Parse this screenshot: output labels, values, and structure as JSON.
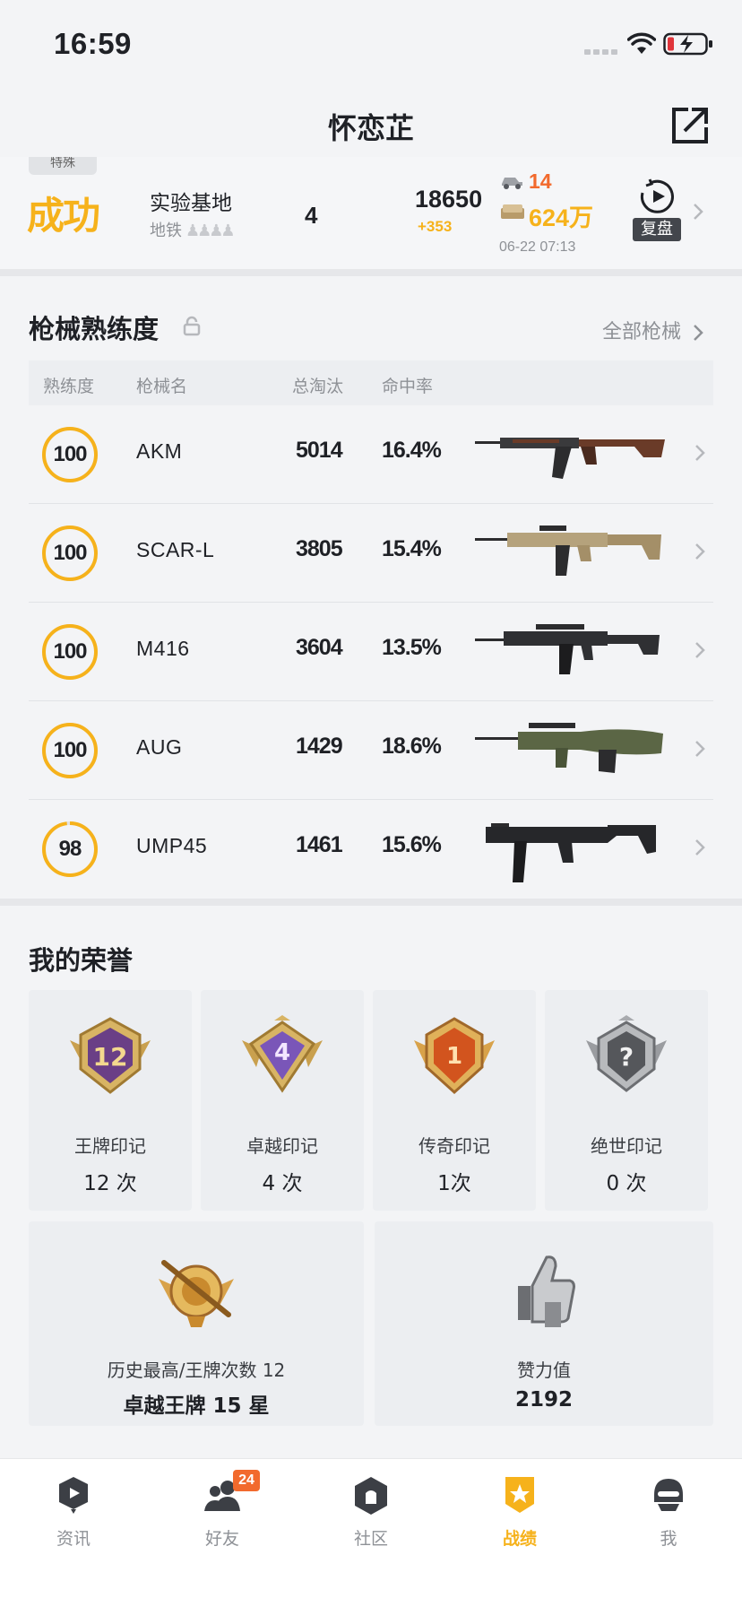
{
  "status_bar": {
    "time": "16:59"
  },
  "header": {
    "title": "怀恋芷"
  },
  "match": {
    "mode_tag": "特殊",
    "result": "成功",
    "map": "实验基地",
    "mode": "地铁",
    "rank": "4",
    "score": "18650",
    "score_delta": "+353",
    "kills": "14",
    "money": "624万",
    "datetime": "06-22 07:13",
    "replay_label": "复盘"
  },
  "weapons": {
    "title": "枪械熟练度",
    "all_link": "全部枪械",
    "columns": [
      "熟练度",
      "枪械名",
      "总淘汰",
      "命中率"
    ],
    "rows": [
      {
        "mastery": "100",
        "mastery_fraction": 1.0,
        "name": "AKM",
        "kills": "5014",
        "hit_rate": "16.4%"
      },
      {
        "mastery": "100",
        "mastery_fraction": 1.0,
        "name": "SCAR-L",
        "kills": "3805",
        "hit_rate": "15.4%"
      },
      {
        "mastery": "100",
        "mastery_fraction": 1.0,
        "name": "M416",
        "kills": "3604",
        "hit_rate": "13.5%"
      },
      {
        "mastery": "100",
        "mastery_fraction": 1.0,
        "name": "AUG",
        "kills": "1429",
        "hit_rate": "18.6%"
      },
      {
        "mastery": "98",
        "mastery_fraction": 0.98,
        "name": "UMP45",
        "kills": "1461",
        "hit_rate": "15.6%"
      }
    ]
  },
  "honors": {
    "title": "我的荣誉",
    "items": [
      {
        "name": "王牌印记",
        "count": "12 次",
        "emblem_text": "12"
      },
      {
        "name": "卓越印记",
        "count": "4 次",
        "emblem_text": "4"
      },
      {
        "name": "传奇印记",
        "count": "1次",
        "emblem_text": "1"
      },
      {
        "name": "绝世印记",
        "count": "0 次",
        "emblem_text": "?"
      }
    ],
    "best": {
      "label": "历史最高/王牌次数 12",
      "value": "卓越王牌 15 星"
    },
    "likes": {
      "label": "赞力值",
      "value": "2192"
    }
  },
  "tabbar": {
    "items": [
      {
        "label": "资讯",
        "icon": "news-icon"
      },
      {
        "label": "好友",
        "icon": "friends-icon",
        "badge": "24"
      },
      {
        "label": "社区",
        "icon": "community-icon"
      },
      {
        "label": "战绩",
        "icon": "record-icon",
        "active": true
      },
      {
        "label": "我",
        "icon": "profile-icon"
      }
    ]
  },
  "colors": {
    "accent": "#f6b21b",
    "orange": "#f26a2d",
    "muted": "#8e9196",
    "background": "#f3f4f6"
  }
}
